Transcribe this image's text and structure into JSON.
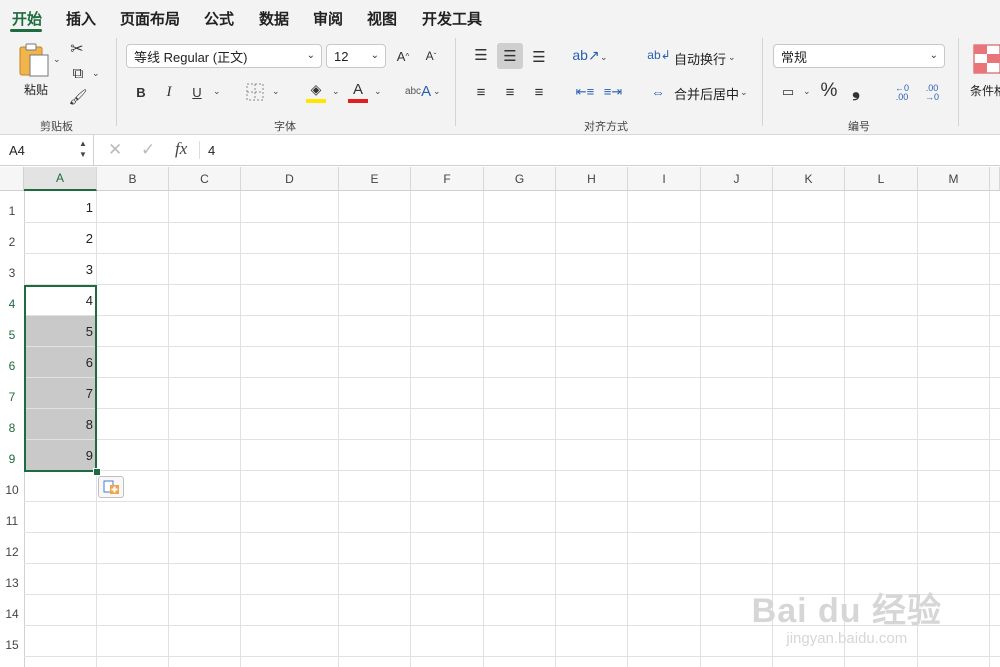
{
  "tabs": [
    "开始",
    "插入",
    "页面布局",
    "公式",
    "数据",
    "审阅",
    "视图",
    "开发工具"
  ],
  "ribbon": {
    "clipboard": {
      "paste_label": "粘贴",
      "group_label": "剪贴板"
    },
    "font": {
      "font_name": "等线 Regular (正文)",
      "font_size": "12",
      "bold": "B",
      "italic": "I",
      "underline": "U",
      "group_label": "字体"
    },
    "alignment": {
      "wrap_label": "自动换行",
      "merge_label": "合并后居中",
      "group_label": "对齐方式"
    },
    "number": {
      "format_value": "常规",
      "percent": "%",
      "comma": "❟",
      "group_label": "编号"
    },
    "conditional": {
      "label": "条件格"
    }
  },
  "formula_bar": {
    "name_box": "A4",
    "fx": "fx",
    "content": "4"
  },
  "sheet": {
    "columns": [
      "A",
      "B",
      "C",
      "D",
      "E",
      "F",
      "G",
      "H",
      "I",
      "J",
      "K",
      "L",
      "M"
    ],
    "rows": [
      "1",
      "2",
      "3",
      "4",
      "5",
      "6",
      "7",
      "8",
      "9",
      "10",
      "11",
      "12",
      "13",
      "14",
      "15"
    ],
    "values": [
      "1",
      "2",
      "3",
      "4",
      "5",
      "6",
      "7",
      "8",
      "9"
    ],
    "selected_range": "A4:A9"
  },
  "watermark": {
    "line1": "Bai du 经验",
    "line2": "jingyan.baidu.com"
  },
  "colors": {
    "accent": "#1d6b3e",
    "selection_fill": "#c9c9c9",
    "font_red": "#e02020",
    "highlight_yellow": "#ffe600"
  }
}
